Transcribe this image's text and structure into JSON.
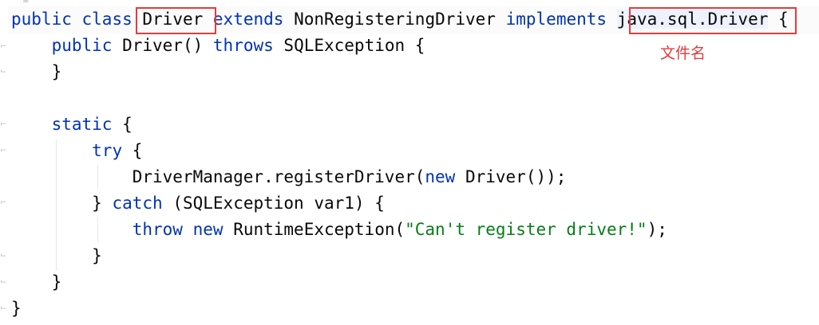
{
  "colors": {
    "keyword": "#0033b3",
    "string": "#067d17",
    "text": "#080808",
    "annotation": "#e33c3c",
    "guide": "#e6e6e6",
    "gutter_marker": "#b7b7b7"
  },
  "code": {
    "line1": {
      "kw1": "public",
      "kw2": "class",
      "class_name": "Driver",
      "kw3": "extends",
      "parent": "NonRegisteringDriver",
      "kw4": "implements",
      "interface": "java.sql.Driver",
      "brace": "{"
    },
    "line2": {
      "kw1": "public",
      "name": "Driver()",
      "kw2": "throws",
      "rest": "SQLException {"
    },
    "line3": {
      "text": "}"
    },
    "line5": {
      "kw": "static",
      "rest": "{"
    },
    "line6": {
      "kw": "try",
      "rest": "{"
    },
    "line7": {
      "pre": "DriverManager.registerDriver(",
      "kw": "new",
      "post": "Driver());"
    },
    "line8": {
      "pre": "}",
      "kw": "catch",
      "rest": "(SQLException var1) {"
    },
    "line9": {
      "kw1": "throw",
      "kw2": "new",
      "mid": "RuntimeException(",
      "str": "\"Can't register driver!\"",
      "post": ");"
    },
    "line10": {
      "text": "}"
    },
    "line11": {
      "text": "}"
    },
    "line12": {
      "text": "}"
    }
  },
  "annotations": {
    "interface_label": "文件名"
  },
  "gutter": {
    "fold_icon": "fold-bracket-icon",
    "top_marker_icon": "equals-icon",
    "top_marker": "="
  }
}
